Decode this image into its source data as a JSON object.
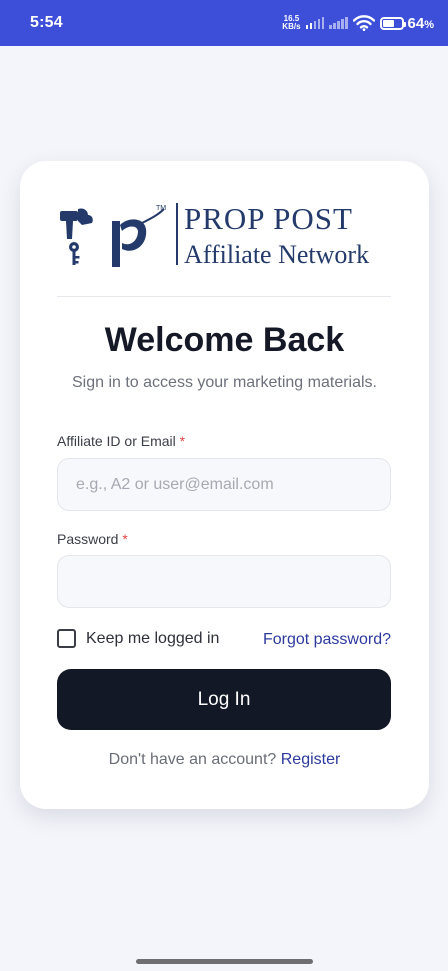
{
  "status_bar": {
    "time": "5:54",
    "net_speed_value": "16.5",
    "net_speed_unit": "KB/s",
    "battery_percent": "64",
    "battery_symbol": "%",
    "battery_level": 0.64
  },
  "logo": {
    "brand_line1": "PROP POST",
    "brand_line2": "Affiliate Network",
    "trademark": "TM",
    "color": "#233a6b"
  },
  "login": {
    "title": "Welcome Back",
    "subtitle": "Sign in to access your marketing materials.",
    "id_label": "Affiliate ID or Email",
    "id_placeholder": "e.g., A2 or user@email.com",
    "id_value": "",
    "password_label": "Password",
    "password_value": "",
    "required_mark": "*",
    "remember_label": "Keep me logged in",
    "remember_checked": false,
    "forgot_label": "Forgot password?",
    "submit_label": "Log In",
    "register_prompt": "Don't have an account?",
    "register_link": "Register"
  },
  "colors": {
    "status_bar": "#3d4fd9",
    "background": "#f4f5fa",
    "primary_button": "#121826",
    "link": "#2d3a9e",
    "required": "#e04646"
  }
}
